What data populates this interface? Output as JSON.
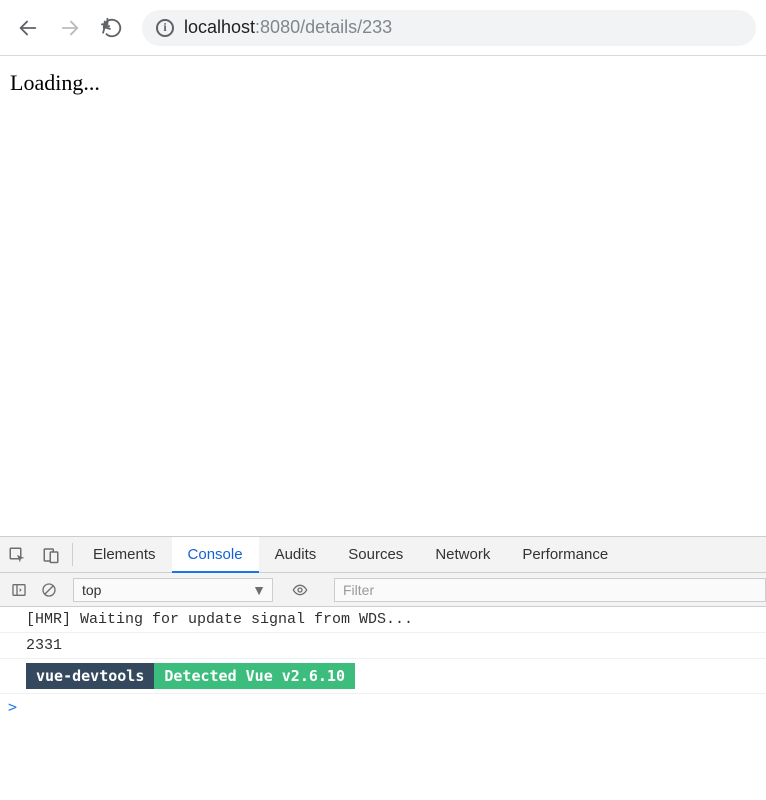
{
  "toolbar": {
    "url_host": "localhost",
    "url_rest": ":8080/details/233"
  },
  "page": {
    "loading_text": "Loading..."
  },
  "devtools": {
    "tabs": {
      "elements": "Elements",
      "console": "Console",
      "audits": "Audits",
      "sources": "Sources",
      "network": "Network",
      "performance": "Performance"
    },
    "subbar": {
      "context_value": "top",
      "filter_placeholder": "Filter"
    },
    "console": {
      "line1": "[HMR] Waiting for update signal from WDS...",
      "line2": "2331",
      "badge_label": "vue-devtools",
      "badge_msg": " Detected Vue v2.6.10 ",
      "prompt": ">"
    }
  }
}
